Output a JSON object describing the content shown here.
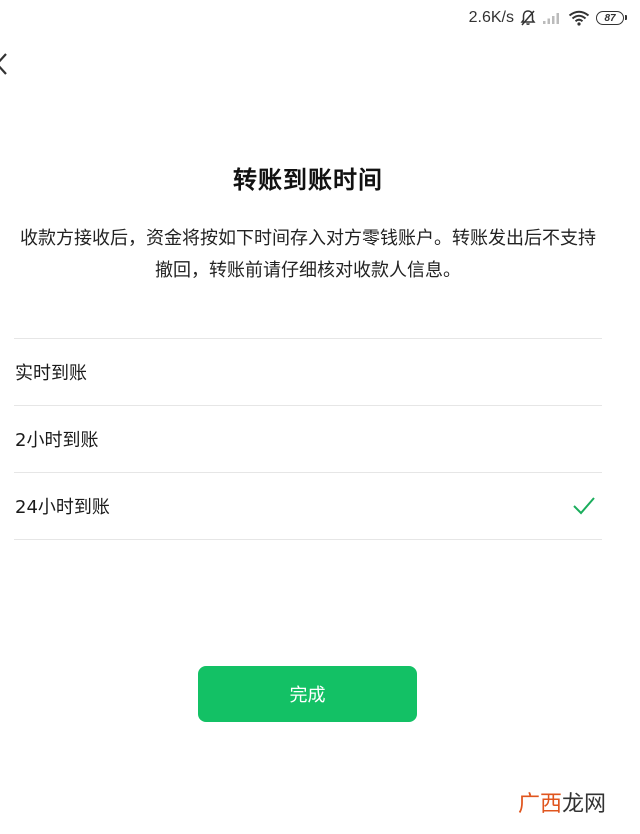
{
  "status_bar": {
    "network_speed": "2.6K/s",
    "battery_level": "87",
    "icons": [
      "bell-muted-icon",
      "signal-icon",
      "wifi-icon",
      "battery-icon"
    ]
  },
  "nav": {
    "back_icon": "chevron-left-icon"
  },
  "page": {
    "title": "转账到账时间",
    "description": "收款方接收后，资金将按如下时间存入对方零钱账户。转账发出后不支持撤回，转账前请仔细核对收款人信息。"
  },
  "options": [
    {
      "label": "实时到账",
      "selected": false
    },
    {
      "label": "2小时到账",
      "selected": false
    },
    {
      "label": "24小时到账",
      "selected": true
    }
  ],
  "done_button": {
    "label": "完成"
  },
  "watermark": {
    "part1": "广西",
    "part2": "龙网"
  },
  "colors": {
    "accent": "#13c165",
    "check": "#1aad5c",
    "text": "#1a1a1a",
    "divider": "#e6e6e6"
  }
}
